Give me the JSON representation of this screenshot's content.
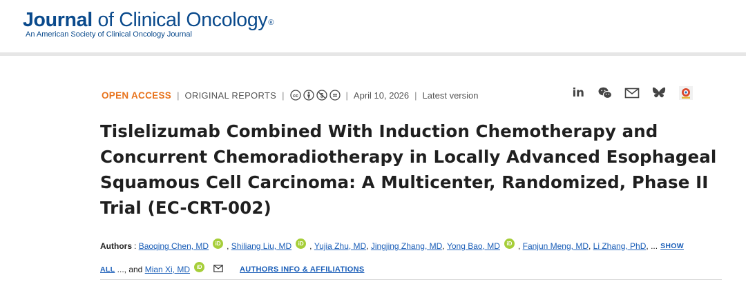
{
  "header": {
    "logo_bold": "Journal",
    "logo_rest": " of Clinical Oncology",
    "logo_reg": "®",
    "logo_sub": "An American Society of Clinical Oncology Journal"
  },
  "meta": {
    "access": "OPEN ACCESS",
    "sep": "|",
    "category": "ORIGINAL REPORTS",
    "date": "April 10, 2026",
    "version": "Latest version",
    "cc_icons": [
      "cc-icon",
      "by-icon",
      "nc-icon",
      "nd-icon"
    ]
  },
  "share": {
    "icons": [
      "linkedin-icon",
      "wechat-icon",
      "email-icon",
      "bluesky-icon",
      "mendeley-icon"
    ],
    "linkedin_label": "in"
  },
  "article": {
    "title": "Tislelizumab Combined With Induction Chemotherapy and Concurrent Chemoradiotherapy in Locally Advanced Esophageal Squamous Cell Carcinoma: A Multicenter, Randomized, Phase II Trial (EC-CRT-002)"
  },
  "authors": {
    "label": "Authors",
    "colon": ":",
    "list": [
      "Baoqing Chen, MD",
      "Shiliang Liu, MD",
      "Yujia Zhu, MD",
      "Jingjing Zhang, MD",
      "Yong Bao, MD",
      "Fanjun Meng, MD",
      "Li Zhang, PhD",
      "Mian Xi, MD"
    ],
    "comma": ",",
    "ellipsis": "...",
    "show": "SHOW",
    "all": "ALL",
    "and_text": "..., and",
    "orcid": "iD",
    "affiliations": "AUTHORS INFO & AFFILIATIONS"
  },
  "colors": {
    "brand_blue": "#0a4a8c",
    "open_access_orange": "#e8731c",
    "link_blue": "#1a5eb8",
    "orcid_green": "#a6ce39"
  }
}
